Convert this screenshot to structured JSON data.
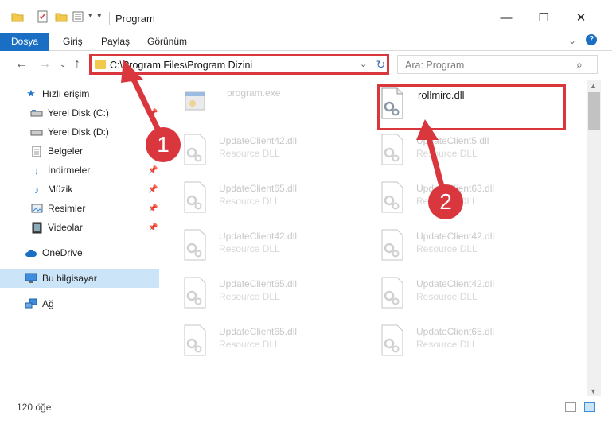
{
  "window": {
    "title": "Program",
    "minimize": "—",
    "maximize": "☐",
    "close": "✕"
  },
  "ribbon": {
    "tabs": [
      {
        "label": "Dosya"
      },
      {
        "label": "Giriş"
      },
      {
        "label": "Paylaş"
      },
      {
        "label": "Görünüm"
      }
    ],
    "help": "?"
  },
  "address": {
    "path": "C:\\Program Files\\Program Dizini"
  },
  "search": {
    "placeholder": "Ara: Program"
  },
  "sidebar": {
    "items": [
      {
        "label": "Hızlı erişim",
        "icon": "star-icon"
      },
      {
        "label": "Yerel Disk (C:)",
        "icon": "drive-icon",
        "pinned": true
      },
      {
        "label": "Yerel Disk (D:)",
        "icon": "drive-icon",
        "pinned": true
      },
      {
        "label": "Belgeler",
        "icon": "document-icon",
        "pinned": true
      },
      {
        "label": "İndirmeler",
        "icon": "download-icon",
        "pinned": true
      },
      {
        "label": "Müzik",
        "icon": "music-icon",
        "pinned": true
      },
      {
        "label": "Resimler",
        "icon": "picture-icon",
        "pinned": true
      },
      {
        "label": "Videolar",
        "icon": "video-icon",
        "pinned": true
      },
      {
        "label": "OneDrive",
        "icon": "cloud-icon"
      },
      {
        "label": "Bu bilgisayar",
        "icon": "computer-icon",
        "selected": true
      },
      {
        "label": "Ağ",
        "icon": "network-icon"
      }
    ]
  },
  "files": [
    {
      "name": "program.exe",
      "desc": ""
    },
    {
      "name": "rollmirc.dll",
      "desc": ""
    },
    {
      "name": "UpdateClient42.dll",
      "desc": "Resource DLL"
    },
    {
      "name": "UpdateClient5.dll",
      "desc": "Resource DLL"
    },
    {
      "name": "UpdateClient65.dll",
      "desc": "Resource DLL"
    },
    {
      "name": "UpdateClient63.dll",
      "desc": "Resource DLL"
    },
    {
      "name": "UpdateClient42.dll",
      "desc": "Resource DLL"
    },
    {
      "name": "UpdateClient42.dll",
      "desc": "Resource DLL"
    },
    {
      "name": "UpdateClient65.dll",
      "desc": "Resource DLL"
    },
    {
      "name": "UpdateClient42.dll",
      "desc": "Resource DLL"
    },
    {
      "name": "UpdateClient65.dll",
      "desc": "Resource DLL"
    },
    {
      "name": "UpdateClient65.dll",
      "desc": "Resource DLL"
    }
  ],
  "status": {
    "count": "120 öğe"
  },
  "annotations": {
    "step1": "1",
    "step2": "2",
    "color": "#d9363e"
  }
}
